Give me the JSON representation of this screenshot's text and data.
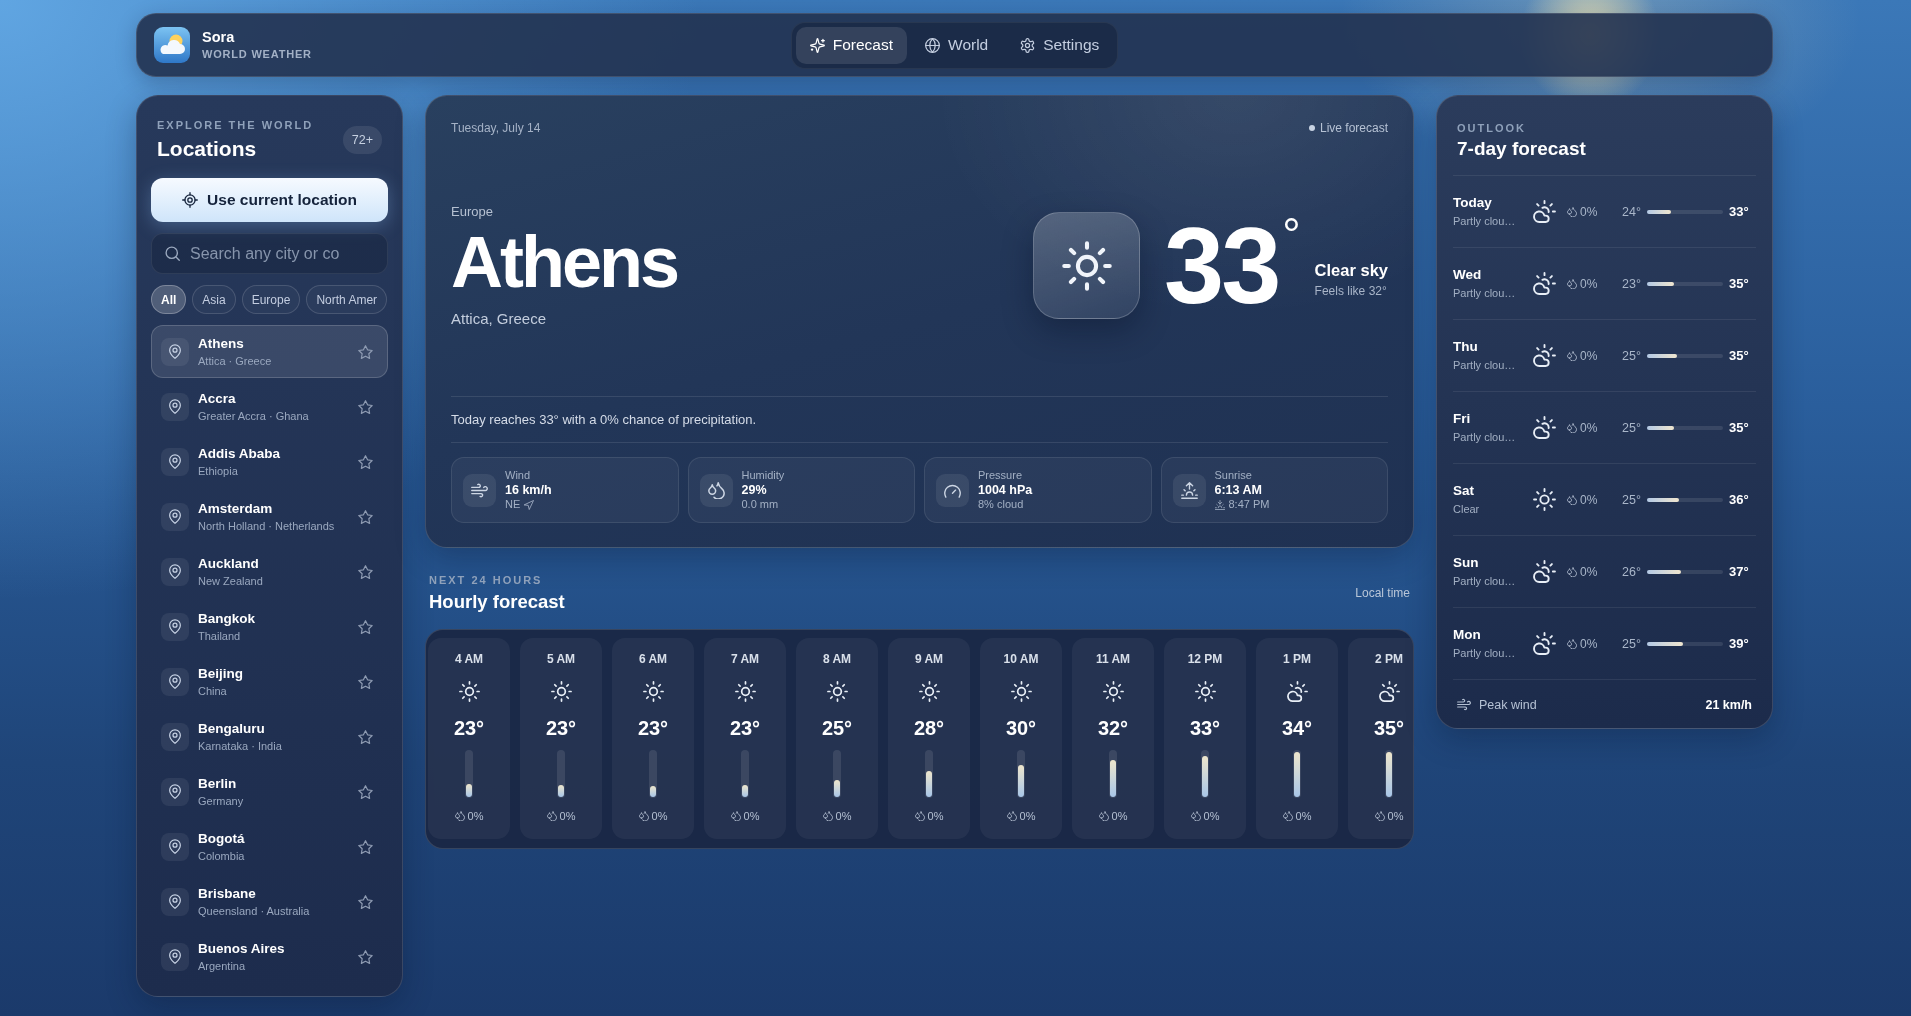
{
  "app": {
    "name": "Sora",
    "subtitle": "WORLD WEATHER"
  },
  "tabs": [
    {
      "label": "Forecast",
      "kind": "forecast",
      "selected": true
    },
    {
      "label": "World",
      "kind": "world",
      "selected": false
    },
    {
      "label": "Settings",
      "kind": "settings",
      "selected": false
    }
  ],
  "sidebar": {
    "eyebrow": "EXPLORE THE WORLD",
    "title": "Locations",
    "count": "72+",
    "locate_button": "Use current location",
    "search": {
      "placeholder": "Search any city or co"
    },
    "filters": [
      {
        "label": "All",
        "selected": true
      },
      {
        "label": "Asia",
        "selected": false
      },
      {
        "label": "Europe",
        "selected": false
      },
      {
        "label": "North Amer",
        "selected": false
      }
    ],
    "locations": [
      {
        "name": "Athens",
        "region": "Attica · Greece",
        "selected": true
      },
      {
        "name": "Accra",
        "region": "Greater Accra · Ghana",
        "selected": false
      },
      {
        "name": "Addis Ababa",
        "region": "Ethiopia",
        "selected": false
      },
      {
        "name": "Amsterdam",
        "region": "North Holland · Netherlands",
        "selected": false
      },
      {
        "name": "Auckland",
        "region": "New Zealand",
        "selected": false
      },
      {
        "name": "Bangkok",
        "region": "Thailand",
        "selected": false
      },
      {
        "name": "Beijing",
        "region": "China",
        "selected": false
      },
      {
        "name": "Bengaluru",
        "region": "Karnataka · India",
        "selected": false
      },
      {
        "name": "Berlin",
        "region": "Germany",
        "selected": false
      },
      {
        "name": "Bogotá",
        "region": "Colombia",
        "selected": false
      },
      {
        "name": "Brisbane",
        "region": "Queensland · Australia",
        "selected": false
      },
      {
        "name": "Buenos Aires",
        "region": "Argentina",
        "selected": false
      }
    ]
  },
  "current": {
    "date": "Tuesday, July 14",
    "live": "Live forecast",
    "continent": "Europe",
    "city": "Athens",
    "region": "Attica, Greece",
    "kind": "clear",
    "temperature": "33$^{°}$",
    "condition": "Clear sky",
    "feels_like": "Feels like 32°",
    "summary": "Today reaches 33° with a 0% chance of precipitation.",
    "stats": [
      {
        "kind": "wind",
        "label": "Wind",
        "value": "16 km/h",
        "detail": "NE"
      },
      {
        "kind": "humidity",
        "label": "Humidity",
        "value": "29%",
        "detail": "0.0 mm"
      },
      {
        "kind": "pressure",
        "label": "Pressure",
        "value": "1004 hPa",
        "detail": "8% cloud"
      },
      {
        "kind": "sunrise",
        "label": "Sunrise",
        "value": "6:13 AM",
        "detail": "8:47 PM"
      }
    ]
  },
  "hourly": {
    "eyebrow": "NEXT 24 HOURS",
    "title": "Hourly forecast",
    "note": "Local time",
    "hours": [
      {
        "time": "4 AM",
        "kind": "clear",
        "temp": "23°",
        "level": 0.28,
        "precip": "0%"
      },
      {
        "time": "5 AM",
        "kind": "clear",
        "temp": "23°",
        "level": 0.27,
        "precip": "0%"
      },
      {
        "time": "6 AM",
        "kind": "clear",
        "temp": "23°",
        "level": 0.24,
        "precip": "0%"
      },
      {
        "time": "7 AM",
        "kind": "clear",
        "temp": "23°",
        "level": 0.27,
        "precip": "0%"
      },
      {
        "time": "8 AM",
        "kind": "clear",
        "temp": "25°",
        "level": 0.36,
        "precip": "0%"
      },
      {
        "time": "9 AM",
        "kind": "clear",
        "temp": "28°",
        "level": 0.57,
        "precip": "0%"
      },
      {
        "time": "10 AM",
        "kind": "clear",
        "temp": "30°",
        "level": 0.69,
        "precip": "0%"
      },
      {
        "time": "11 AM",
        "kind": "clear",
        "temp": "32°",
        "level": 0.81,
        "precip": "0%"
      },
      {
        "time": "12 PM",
        "kind": "clear",
        "temp": "33°",
        "level": 0.9,
        "precip": "0%"
      },
      {
        "time": "1 PM",
        "kind": "partly_cloudy",
        "temp": "34°",
        "level": 0.97,
        "precip": "0%"
      },
      {
        "time": "2 PM",
        "kind": "partly_cloudy",
        "temp": "35°",
        "level": 0.97,
        "precip": "0%"
      }
    ]
  },
  "daily": {
    "eyebrow": "OUTLOOK",
    "title": "7-day forecast",
    "days": [
      {
        "day": "Today",
        "condition": "Partly clou…",
        "kind": "partly_cloudy",
        "precip": "0%",
        "low": "24°",
        "level": 0.32,
        "high": "33°"
      },
      {
        "day": "Wed",
        "condition": "Partly clou…",
        "kind": "partly_cloudy",
        "precip": "0%",
        "low": "23°",
        "level": 0.36,
        "high": "35°"
      },
      {
        "day": "Thu",
        "condition": "Partly clou…",
        "kind": "partly_cloudy",
        "precip": "0%",
        "low": "25°",
        "level": 0.39,
        "high": "35°"
      },
      {
        "day": "Fri",
        "condition": "Partly clou…",
        "kind": "partly_cloudy",
        "precip": "0%",
        "low": "25°",
        "level": 0.36,
        "high": "35°"
      },
      {
        "day": "Sat",
        "condition": "Clear",
        "kind": "clear",
        "precip": "0%",
        "low": "25°",
        "level": 0.42,
        "high": "36°"
      },
      {
        "day": "Sun",
        "condition": "Partly clou…",
        "kind": "partly_cloudy",
        "precip": "0%",
        "low": "26°",
        "level": 0.45,
        "high": "37°"
      },
      {
        "day": "Mon",
        "condition": "Partly clou…",
        "kind": "partly_cloudy",
        "precip": "0%",
        "low": "25°",
        "level": 0.48,
        "high": "39°"
      }
    ],
    "footer": {
      "label": "Peak wind",
      "value": "21 km/h"
    }
  }
}
